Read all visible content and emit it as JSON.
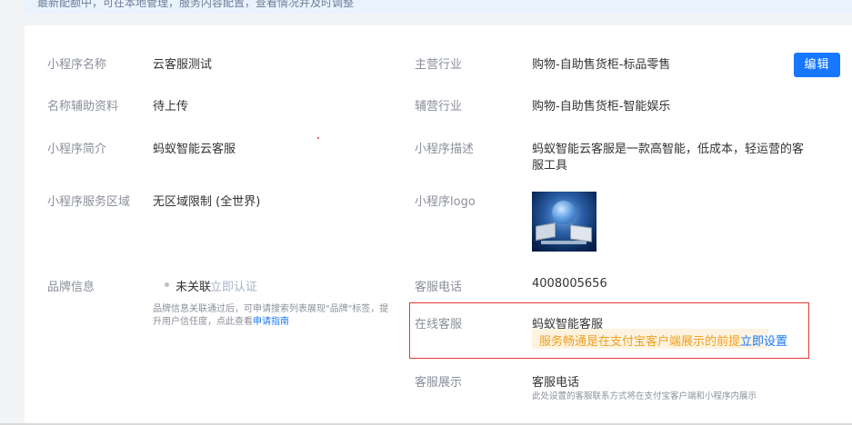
{
  "banner": {
    "text": "最新配额中，可在本地管理，服务内容配置，查看情况并及时调整"
  },
  "actions": {
    "edit_label": "编辑"
  },
  "left_fields": [
    {
      "label": "小程序名称",
      "value": "云客服测试"
    },
    {
      "label": "名称辅助资料",
      "value": "待上传"
    },
    {
      "label": "小程序简介",
      "value": "蚂蚁智能云客服"
    },
    {
      "label": "小程序服务区域",
      "value": "无区域限制 (全世界)"
    }
  ],
  "brand": {
    "label": "品牌信息",
    "status": "未关联",
    "action": "立即认证",
    "note": "品牌信息关联通过后，可申请搜索列表展现\"品牌\"标签，提升用户信任度，点此查看",
    "note_link": "申请指南"
  },
  "right_fields": {
    "main_industry": {
      "label": "主营行业",
      "value": "购物-自助售货柜-标品零售"
    },
    "sub_industry": {
      "label": "辅营行业",
      "value": "购物-自助售货柜-智能娱乐"
    },
    "description": {
      "label": "小程序描述",
      "line1": "蚂蚁智能云客服是一款高智能，低成本，轻运营的客",
      "line2": "服工具"
    },
    "logo": {
      "label": "小程序logo",
      "icon": "globe-computers-logo"
    },
    "phone": {
      "label": "客服电话",
      "value": "4008005656"
    }
  },
  "online_service": {
    "label": "在线客服",
    "value": "蚂蚁智能客服",
    "notice": "服务畅通是在支付宝客户端展示的前提",
    "notice_link": "立即设置",
    "highlight_color": "#e53935"
  },
  "service_display": {
    "label": "客服展示",
    "value": "客服电话",
    "note": "此处设置的客服联系方式将在支付宝客户端和小程序内展示"
  }
}
